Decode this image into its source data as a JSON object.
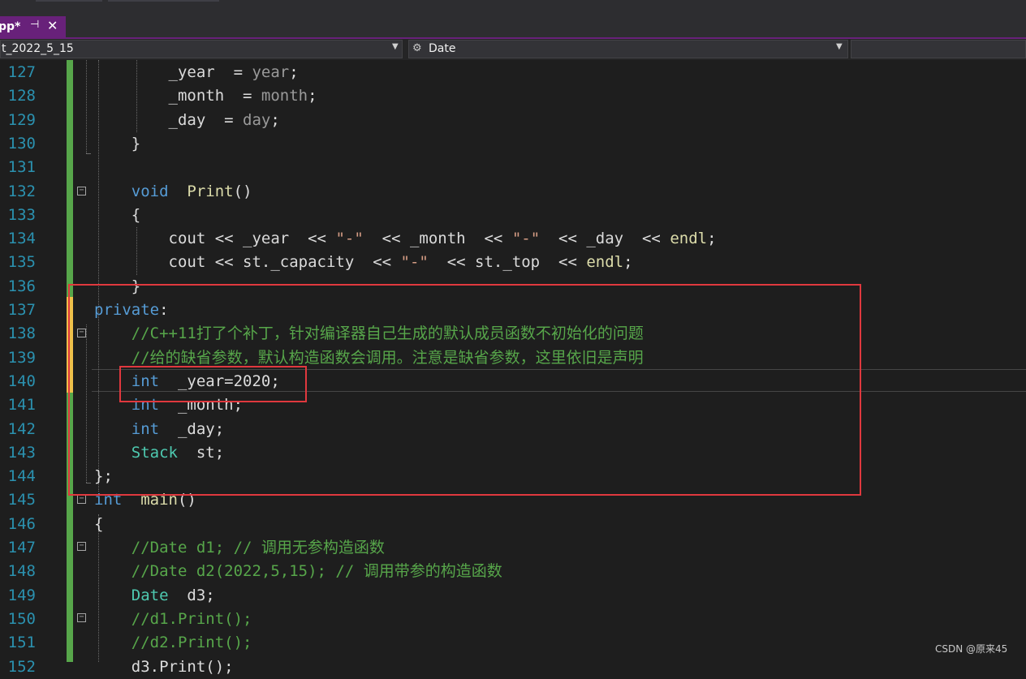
{
  "tab": {
    "label": "pp*",
    "pin_icon": "pin-icon",
    "close_icon": "close-icon"
  },
  "nav": {
    "project": "t_2022_5_15",
    "member": "Date",
    "member_icon": "class-member-icon"
  },
  "lines": [
    {
      "num": "127",
      "tokens": [
        {
          "t": "    _year",
          "c": "mb"
        },
        {
          "t": " = ",
          "c": "op"
        },
        {
          "t": "year",
          "c": "pa"
        },
        {
          "t": ";",
          "c": "op"
        }
      ]
    },
    {
      "num": "128",
      "tokens": [
        {
          "t": "    _month",
          "c": "mb"
        },
        {
          "t": " = ",
          "c": "op"
        },
        {
          "t": "month",
          "c": "pa"
        },
        {
          "t": ";",
          "c": "op"
        }
      ]
    },
    {
      "num": "129",
      "tokens": [
        {
          "t": "    _day",
          "c": "mb"
        },
        {
          "t": " = ",
          "c": "op"
        },
        {
          "t": "day",
          "c": "pa"
        },
        {
          "t": ";",
          "c": "op"
        }
      ]
    },
    {
      "num": "130",
      "tokens": [
        {
          "t": "  }",
          "c": "op"
        }
      ]
    },
    {
      "num": "131",
      "tokens": [
        {
          "t": "",
          "c": "op"
        }
      ]
    },
    {
      "num": "132",
      "tokens": [
        {
          "t": "  ",
          "c": "op"
        },
        {
          "t": "void",
          "c": "kw"
        },
        {
          "t": " ",
          "c": "op"
        },
        {
          "t": "Print",
          "c": "fn"
        },
        {
          "t": "()",
          "c": "op"
        }
      ]
    },
    {
      "num": "133",
      "tokens": [
        {
          "t": "  {",
          "c": "op"
        }
      ]
    },
    {
      "num": "134",
      "tokens": [
        {
          "t": "    cout << ",
          "c": "op"
        },
        {
          "t": "_year",
          "c": "mb"
        },
        {
          "t": " << ",
          "c": "op"
        },
        {
          "t": "\"-\"",
          "c": "st"
        },
        {
          "t": " << ",
          "c": "op"
        },
        {
          "t": "_month",
          "c": "mb"
        },
        {
          "t": " << ",
          "c": "op"
        },
        {
          "t": "\"-\"",
          "c": "st"
        },
        {
          "t": " << ",
          "c": "op"
        },
        {
          "t": "_day",
          "c": "mb"
        },
        {
          "t": " << ",
          "c": "op"
        },
        {
          "t": "endl",
          "c": "fn"
        },
        {
          "t": ";",
          "c": "op"
        }
      ]
    },
    {
      "num": "135",
      "tokens": [
        {
          "t": "    cout << ",
          "c": "op"
        },
        {
          "t": "st._capacity",
          "c": "mb"
        },
        {
          "t": " << ",
          "c": "op"
        },
        {
          "t": "\"-\"",
          "c": "st"
        },
        {
          "t": " << ",
          "c": "op"
        },
        {
          "t": "st._top",
          "c": "mb"
        },
        {
          "t": " << ",
          "c": "op"
        },
        {
          "t": "endl",
          "c": "fn"
        },
        {
          "t": ";",
          "c": "op"
        }
      ]
    },
    {
      "num": "136",
      "tokens": [
        {
          "t": "  }",
          "c": "op"
        }
      ]
    },
    {
      "num": "137",
      "tokens": [
        {
          "t": "private",
          "c": "kw"
        },
        {
          "t": ":",
          "c": "op"
        }
      ]
    },
    {
      "num": "138",
      "tokens": [
        {
          "t": "  //C++11打了个补丁，针对编译器自己生成的默认成员函数不初始化的问题",
          "c": "cm"
        }
      ]
    },
    {
      "num": "139",
      "tokens": [
        {
          "t": "  //给的缺省参数，默认构造函数会调用。注意是缺省参数，这里依旧是声明",
          "c": "cm"
        }
      ]
    },
    {
      "num": "140",
      "tokens": [
        {
          "t": "  ",
          "c": "op"
        },
        {
          "t": "int",
          "c": "kw"
        },
        {
          "t": " _year=2020;",
          "c": "op"
        }
      ]
    },
    {
      "num": "141",
      "tokens": [
        {
          "t": "  ",
          "c": "op"
        },
        {
          "t": "int",
          "c": "kw"
        },
        {
          "t": " _month;",
          "c": "op"
        }
      ]
    },
    {
      "num": "142",
      "tokens": [
        {
          "t": "  ",
          "c": "op"
        },
        {
          "t": "int",
          "c": "kw"
        },
        {
          "t": " _day;",
          "c": "op"
        }
      ]
    },
    {
      "num": "143",
      "tokens": [
        {
          "t": "  ",
          "c": "op"
        },
        {
          "t": "Stack",
          "c": "ty"
        },
        {
          "t": " st;",
          "c": "op"
        }
      ]
    },
    {
      "num": "144",
      "tokens": [
        {
          "t": "};",
          "c": "op"
        }
      ]
    },
    {
      "num": "145",
      "tokens": [
        {
          "t": "int",
          "c": "kw"
        },
        {
          "t": " ",
          "c": "op"
        },
        {
          "t": "main",
          "c": "fn"
        },
        {
          "t": "()",
          "c": "op"
        }
      ]
    },
    {
      "num": "146",
      "tokens": [
        {
          "t": "{",
          "c": "op"
        }
      ]
    },
    {
      "num": "147",
      "tokens": [
        {
          "t": "  //Date d1; // 调用无参构造函数",
          "c": "cm"
        }
      ]
    },
    {
      "num": "148",
      "tokens": [
        {
          "t": "  //Date d2(2022,5,15); // 调用带参的构造函数",
          "c": "cm"
        }
      ]
    },
    {
      "num": "149",
      "tokens": [
        {
          "t": "  ",
          "c": "op"
        },
        {
          "t": "Date",
          "c": "ty"
        },
        {
          "t": " d3;",
          "c": "op"
        }
      ]
    },
    {
      "num": "150",
      "tokens": [
        {
          "t": "  //d1.Print();",
          "c": "cm"
        }
      ]
    },
    {
      "num": "151",
      "tokens": [
        {
          "t": "  //d2.Print();",
          "c": "cm"
        }
      ]
    },
    {
      "num": "152",
      "tokens": [
        {
          "t": "  d3.Print();",
          "c": "op"
        }
      ]
    }
  ],
  "watermark": "CSDN @原来45",
  "colors": {
    "keyword": "#569cd6",
    "type": "#4ec9b0",
    "function": "#dcdcaa",
    "comment": "#57a64a",
    "parameter": "#9a9a9a",
    "string": "#d69d85",
    "accent": "#68217a",
    "highlight_box": "#e0383e"
  }
}
